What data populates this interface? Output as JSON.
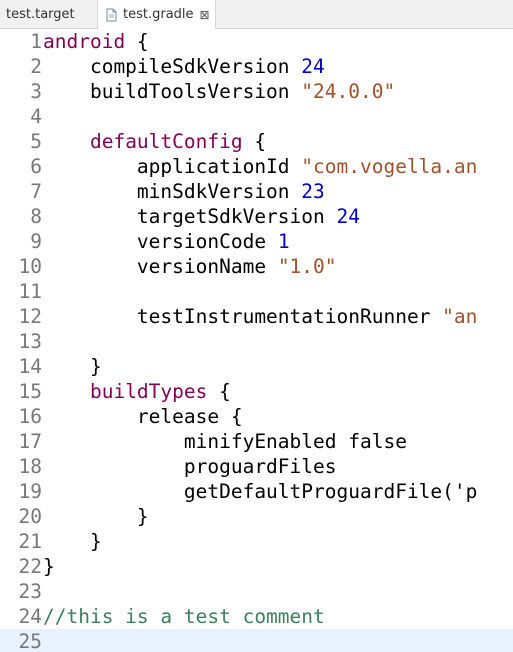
{
  "tabs": [
    {
      "label": "test.target",
      "active": false
    },
    {
      "label": "test.gradle",
      "active": true,
      "close_glyph": "⊠"
    }
  ],
  "editor": {
    "current_line": 25,
    "colors": {
      "keyword": "#7f0055",
      "number": "#0000c0",
      "string": "#a0522d",
      "comment": "#3f7f5f",
      "line_number": "#787878",
      "current_line_bg": "#e8f2fe"
    },
    "lines": [
      {
        "n": "1",
        "tokens": [
          {
            "t": "android",
            "c": "kw"
          },
          {
            "t": " {",
            "c": ""
          }
        ]
      },
      {
        "n": "2",
        "tokens": [
          {
            "t": "    compileSdkVersion ",
            "c": ""
          },
          {
            "t": "24",
            "c": "num"
          }
        ]
      },
      {
        "n": "3",
        "tokens": [
          {
            "t": "    buildToolsVersion ",
            "c": ""
          },
          {
            "t": "\"24.0.0\"",
            "c": "str"
          }
        ]
      },
      {
        "n": "4",
        "tokens": []
      },
      {
        "n": "5",
        "tokens": [
          {
            "t": "    ",
            "c": ""
          },
          {
            "t": "defaultConfig",
            "c": "kw"
          },
          {
            "t": " {",
            "c": ""
          }
        ]
      },
      {
        "n": "6",
        "tokens": [
          {
            "t": "        applicationId ",
            "c": ""
          },
          {
            "t": "\"com.vogella.an",
            "c": "str"
          }
        ]
      },
      {
        "n": "7",
        "tokens": [
          {
            "t": "        minSdkVersion ",
            "c": ""
          },
          {
            "t": "23",
            "c": "num"
          }
        ]
      },
      {
        "n": "8",
        "tokens": [
          {
            "t": "        targetSdkVersion ",
            "c": ""
          },
          {
            "t": "24",
            "c": "num"
          }
        ]
      },
      {
        "n": "9",
        "tokens": [
          {
            "t": "        versionCode ",
            "c": ""
          },
          {
            "t": "1",
            "c": "num"
          }
        ]
      },
      {
        "n": "10",
        "tokens": [
          {
            "t": "        versionName ",
            "c": ""
          },
          {
            "t": "\"1.0\"",
            "c": "str"
          }
        ]
      },
      {
        "n": "11",
        "tokens": []
      },
      {
        "n": "12",
        "tokens": [
          {
            "t": "        testInstrumentationRunner ",
            "c": ""
          },
          {
            "t": "\"an",
            "c": "str"
          }
        ]
      },
      {
        "n": "13",
        "tokens": []
      },
      {
        "n": "14",
        "tokens": [
          {
            "t": "    }",
            "c": ""
          }
        ]
      },
      {
        "n": "15",
        "tokens": [
          {
            "t": "    ",
            "c": ""
          },
          {
            "t": "buildTypes",
            "c": "kw"
          },
          {
            "t": " {",
            "c": ""
          }
        ]
      },
      {
        "n": "16",
        "tokens": [
          {
            "t": "        release {",
            "c": ""
          }
        ]
      },
      {
        "n": "17",
        "tokens": [
          {
            "t": "            minifyEnabled false",
            "c": ""
          }
        ]
      },
      {
        "n": "18",
        "tokens": [
          {
            "t": "            proguardFiles",
            "c": ""
          }
        ]
      },
      {
        "n": "19",
        "tokens": [
          {
            "t": "            getDefaultProguardFile('p",
            "c": ""
          }
        ]
      },
      {
        "n": "20",
        "tokens": [
          {
            "t": "        }",
            "c": ""
          }
        ]
      },
      {
        "n": "21",
        "tokens": [
          {
            "t": "    }",
            "c": ""
          }
        ]
      },
      {
        "n": "22",
        "tokens": [
          {
            "t": "}",
            "c": ""
          }
        ]
      },
      {
        "n": "23",
        "tokens": []
      },
      {
        "n": "24",
        "tokens": [
          {
            "t": "//this is a test comment",
            "c": "cmt"
          }
        ]
      },
      {
        "n": "25",
        "tokens": []
      }
    ]
  }
}
